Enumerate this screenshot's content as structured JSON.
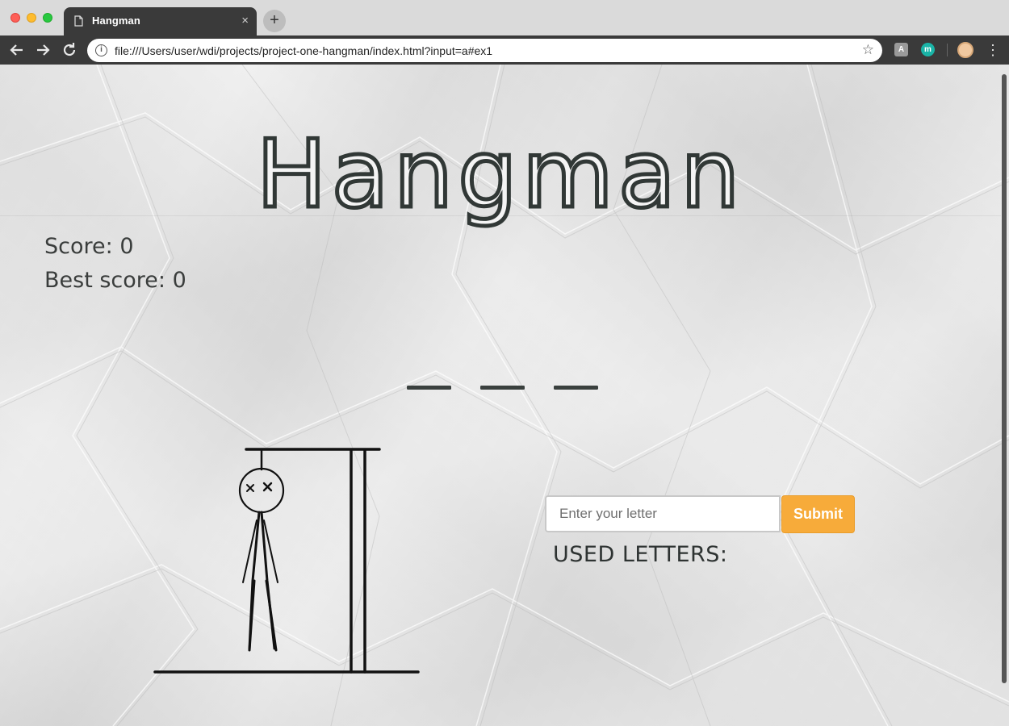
{
  "browser": {
    "tab": {
      "title": "Hangman",
      "close": "×"
    },
    "new_tab": "+",
    "url": "file:///Users/user/wdi/projects/project-one-hangman/index.html?input=a#ex1",
    "extensions": [
      "A",
      "m"
    ]
  },
  "game": {
    "title": "Hangman",
    "score_label": "Score:",
    "score_value": "0",
    "best_score_label": "Best score:",
    "best_score_value": "0",
    "word_blanks": [
      "_",
      "_",
      "_"
    ],
    "input": {
      "placeholder": "Enter your letter",
      "value": ""
    },
    "submit_label": "Submit",
    "used_letters_label": "USED LETTERS:",
    "used_letters": []
  },
  "colors": {
    "accent": "#f7ab3a",
    "title_ink": "#313836",
    "text": "#3a3d3c"
  },
  "icons": [
    "back-arrow-icon",
    "forward-arrow-icon",
    "reload-icon",
    "info-icon",
    "star-icon",
    "menu-icon",
    "page-icon",
    "hangman-figure-icon"
  ]
}
